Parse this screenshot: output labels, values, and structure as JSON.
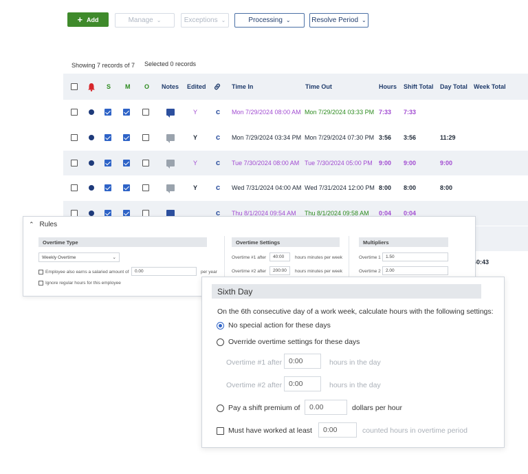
{
  "toolbar": {
    "add_label": "Add",
    "manage_label": "Manage",
    "exceptions_label": "Exceptions",
    "processing_label": "Processing",
    "resolve_label": "Resolve Period"
  },
  "meta": {
    "showing": "Showing 7 records of 7",
    "selected": "Selected 0 records"
  },
  "columns": {
    "notes": "Notes",
    "edited": "Edited",
    "time_in": "Time In",
    "time_out": "Time Out",
    "hours": "Hours",
    "shift_total": "Shift Total",
    "day_total": "Day Total",
    "week_total": "Week Total",
    "col_s": "S",
    "col_m": "M",
    "col_o": "O"
  },
  "rows": [
    {
      "edited": "Y",
      "time_in": "Mon 7/29/2024 08:00 AM",
      "time_out": "Mon 7/29/2024 03:33 PM",
      "hours": "7:33",
      "shift_total": "7:33",
      "day_total": "",
      "week_total": ""
    },
    {
      "edited": "Y",
      "time_in": "Mon 7/29/2024 03:34 PM",
      "time_out": "Mon 7/29/2024 07:30 PM",
      "hours": "3:56",
      "shift_total": "3:56",
      "day_total": "11:29",
      "week_total": ""
    },
    {
      "edited": "Y",
      "time_in": "Tue 7/30/2024 08:00 AM",
      "time_out": "Tue 7/30/2024 05:00 PM",
      "hours": "9:00",
      "shift_total": "9:00",
      "day_total": "9:00",
      "week_total": ""
    },
    {
      "edited": "Y",
      "time_in": "Wed 7/31/2024 04:00 AM",
      "time_out": "Wed 7/31/2024 12:00 PM",
      "hours": "8:00",
      "shift_total": "8:00",
      "day_total": "8:00",
      "week_total": ""
    },
    {
      "edited": "",
      "time_in": "Thu 8/1/2024 09:54 AM",
      "time_out": "Thu 8/1/2024 09:58 AM",
      "hours": "0:04",
      "shift_total": "0:04",
      "day_total": "",
      "week_total": ""
    }
  ],
  "week_total_value": "40:43",
  "rules": {
    "title": "Rules",
    "overtime_type_head": "Overtime Type",
    "overtime_type_value": "Weekly Overtime",
    "salaried_label": "Employee also earns a salaried amount of",
    "salaried_value": "0.00",
    "per_year": "per year",
    "ignore_label": "Ignore regular hours for this employee",
    "overtime_settings_head": "Overtime Settings",
    "ot1_label": "Overtime #1 after",
    "ot1_value": "40:00",
    "ot1_unit": "hours minutes per week",
    "ot2_label": "Overtime #2 after",
    "ot2_value": "200:00",
    "ot2_unit": "hours minutes per week",
    "multipliers_head": "Multipliers",
    "mult1_label": "Overtime 1",
    "mult1_value": "1.50",
    "mult2_label": "Overtime 2",
    "mult2_value": "2.00"
  },
  "sixth_day": {
    "title": "Sixth Day",
    "description": "On the 6th consecutive day of a work week, calculate hours with the following settings:",
    "option_none": "No special action for these days",
    "option_override": "Override overtime settings for these days",
    "ot1_label": "Overtime #1 after",
    "ot1_value": "0:00",
    "ot1_unit": "hours in the day",
    "ot2_label": "Overtime #2 after",
    "ot2_value": "0:00",
    "ot2_unit": "hours in the day",
    "premium_label": "Pay a shift premium of",
    "premium_value": "0.00",
    "premium_unit": "dollars per hour",
    "must_label": "Must have worked at least",
    "must_value": "0:00",
    "must_unit": "counted hours in overtime period"
  },
  "colors": {
    "accent_green": "#3f8a2b",
    "edited_purple": "#a14bd1",
    "timeout_green": "#2c8a1e",
    "navy": "#1f3b6b",
    "checkbox_blue": "#2e63c7",
    "alarm_red": "#d7262b"
  }
}
